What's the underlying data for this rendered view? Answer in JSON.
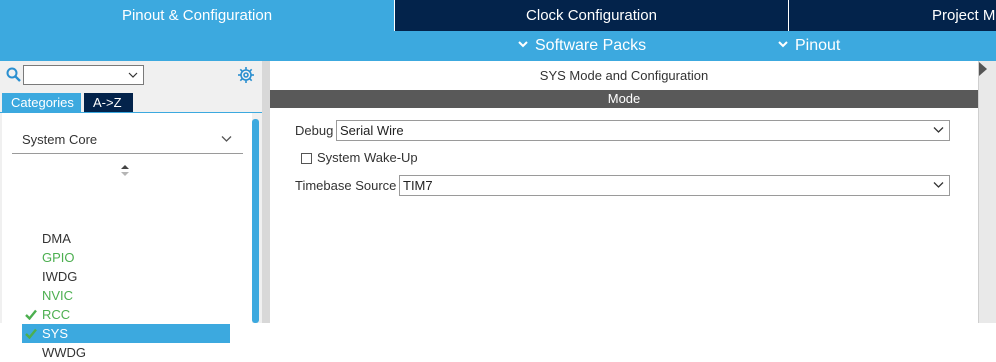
{
  "top_tabs": [
    {
      "label": "Pinout & Configuration",
      "active": true
    },
    {
      "label": "Clock Configuration",
      "active": false
    },
    {
      "label": "Project Ma",
      "active": false
    }
  ],
  "sub_menu": {
    "software_packs": "Software Packs",
    "pinout": "Pinout"
  },
  "left_panel": {
    "search": {
      "value": "",
      "placeholder": ""
    },
    "category_tabs": {
      "categories": "Categories",
      "az": "A->Z"
    },
    "group": {
      "label": "System Core",
      "items": [
        {
          "label": "DMA",
          "status": "none"
        },
        {
          "label": "GPIO",
          "status": "configured"
        },
        {
          "label": "IWDG",
          "status": "none"
        },
        {
          "label": "NVIC",
          "status": "configured"
        },
        {
          "label": "RCC",
          "status": "checked"
        },
        {
          "label": "SYS",
          "status": "checked-selected"
        },
        {
          "label": "WWDG",
          "status": "none"
        }
      ]
    }
  },
  "main": {
    "title": "SYS Mode and Configuration",
    "mode_header": "Mode",
    "debug": {
      "label": "Debug",
      "value": "Serial Wire"
    },
    "wakeup": {
      "label": "System Wake-Up",
      "checked": false
    },
    "timebase": {
      "label": "Timebase Source",
      "value": "TIM7"
    }
  },
  "colors": {
    "navy": "#03234b",
    "accent": "#3ca9df",
    "green": "#4caf50",
    "mode_bar": "#595959"
  },
  "icons": {
    "search": "search-icon",
    "settings": "gear-icon",
    "dropdown": "chevron-down-icon",
    "sort": "sort-arrows-icon",
    "check": "check-icon"
  }
}
